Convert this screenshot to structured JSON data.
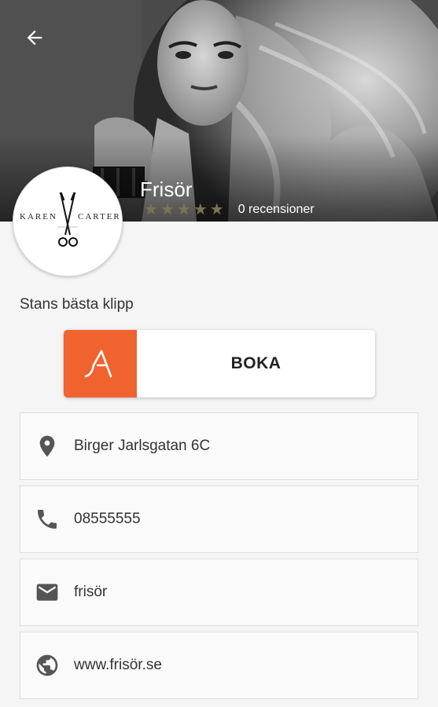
{
  "header": {
    "back_icon": "arrow-left-icon",
    "title": "Frisör",
    "rating": {
      "value": 0,
      "max": 5
    },
    "reviews_label": "0 recensioner"
  },
  "logo": {
    "left_text": "KAREN",
    "right_text": "CARTER",
    "icon": "scissors-icon"
  },
  "tagline": "Stans bästa klipp",
  "booking": {
    "label": "BOKA",
    "brand_color": "#f0622e",
    "brand_icon": "booking-logo-icon"
  },
  "contact": {
    "address": "Birger Jarlsgatan 6C",
    "phone": "08555555",
    "email": "frisör",
    "website": "www.frisör.se"
  }
}
